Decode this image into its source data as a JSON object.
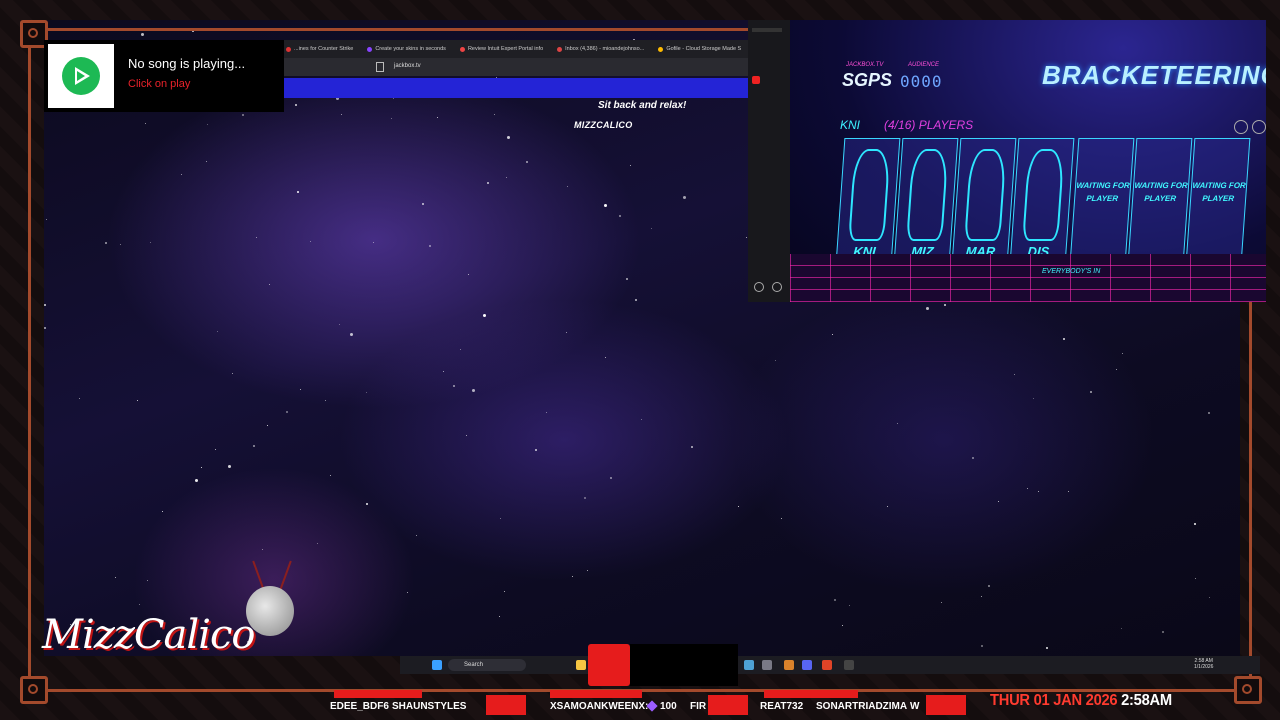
{
  "song_widget": {
    "title": "No song is playing...",
    "subtitle": "Click on play"
  },
  "browser": {
    "tabs": [
      "...ines for Counter Strike",
      "Create your skins in seconds",
      "Review Intuit Expert Portal info",
      "Inbox (4,386) - mioandejohnso...",
      "Gofile - Cloud Storage Made S"
    ],
    "url": "jackbox.tv",
    "room_name": "MIZZCALICO",
    "message": "Sit back and relax!"
  },
  "game": {
    "site": "JACKBOX.TV",
    "room_code": "SGPS",
    "audience_label": "AUDIENCE",
    "audience_count": "0000",
    "title": "BRACKETEERING",
    "first_player_tag": "KNI",
    "players_count": "(4/16) PLAYERS",
    "players": [
      "KNI",
      "MIZ",
      "MAR",
      "DIS"
    ],
    "waiting_text": "WAITING FOR PLAYER",
    "footer": "EVERYBODY'S IN"
  },
  "taskbar": {
    "search_placeholder": "Search",
    "time": "2:58 AM",
    "date": "1/1/2026"
  },
  "branding": {
    "logo_text": "MizzCalico"
  },
  "ticker": {
    "names": [
      "EDEE_BDF6",
      "SHAUNSTYLES",
      "XSAMOANKWEENX:",
      "100",
      "FIR",
      "REAT732",
      "SONARTRIADZIMA",
      "W"
    ]
  },
  "datetime": {
    "date": "THUR 01 JAN 2026",
    "time": "2:58AM"
  },
  "colors": {
    "accent_red": "#e61c1c",
    "frame": "#a34a2c",
    "game_cyan": "#40f7ff",
    "game_magenta": "#e040e0"
  }
}
